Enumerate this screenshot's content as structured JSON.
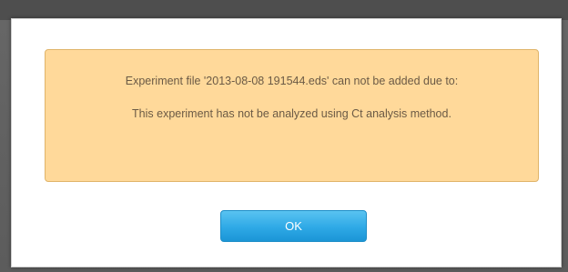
{
  "dialog": {
    "message": {
      "line1": "Experiment file '2013-08-08 191544.eds' can not be added due to:",
      "line2": "This experiment has not be analyzed using Ct analysis method."
    },
    "ok_label": "OK"
  },
  "colors": {
    "message_background": "#ffd99a",
    "message_border": "#e0b46a",
    "message_text": "#6b5a45",
    "button_accent": "#2ea9e6"
  }
}
